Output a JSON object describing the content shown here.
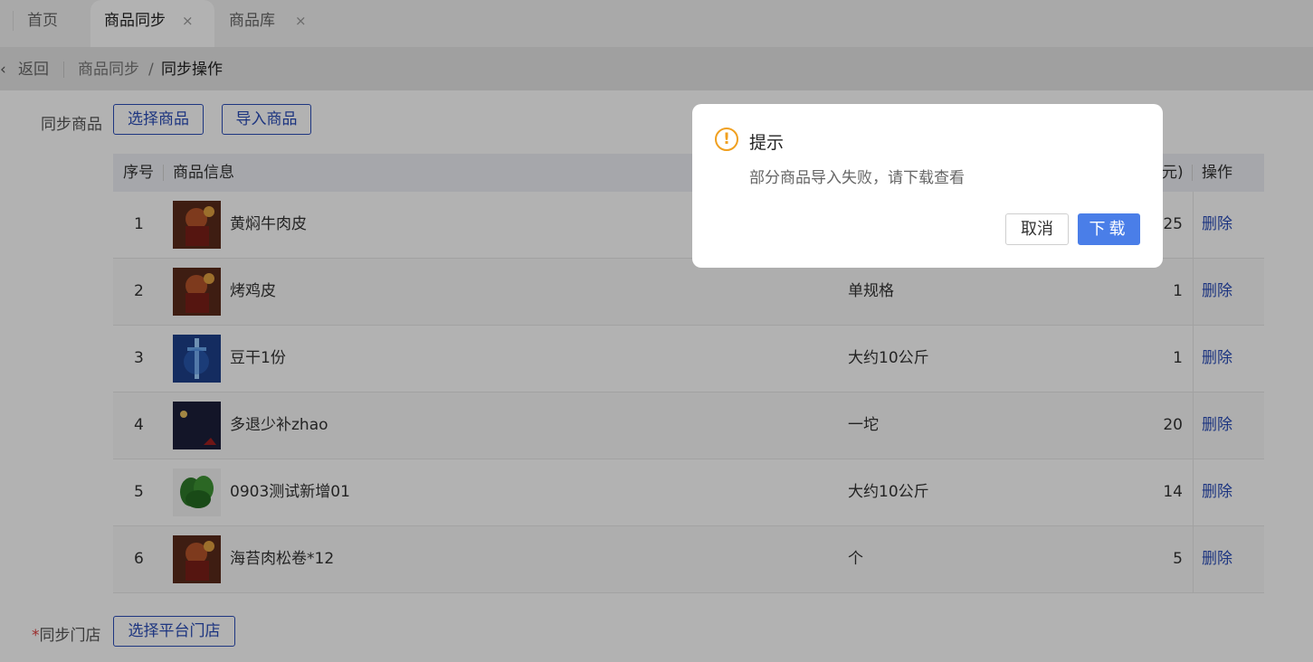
{
  "tabs": [
    {
      "label": "首页",
      "closable": false,
      "active": false
    },
    {
      "label": "商品同步",
      "closable": true,
      "active": true
    },
    {
      "label": "商品库",
      "closable": true,
      "active": false
    }
  ],
  "close_glyph": "×",
  "breadcrumb": {
    "back_label": "返回",
    "parent": "商品同步",
    "separator": "/",
    "current": "同步操作"
  },
  "form": {
    "sync_goods_label": "同步商品",
    "select_goods_button": "选择商品",
    "import_goods_button": "导入商品",
    "sync_store_required_mark": "*",
    "sync_store_label": "同步门店",
    "select_store_button": "选择平台门店"
  },
  "table": {
    "headers": {
      "index": "序号",
      "info": "商品信息",
      "price_partial": "元)",
      "action": "操作"
    },
    "rows": [
      {
        "index": "1",
        "name": "黄焖牛肉皮",
        "spec": "",
        "price": "25",
        "action": "删除",
        "thumb": "warrior-image"
      },
      {
        "index": "2",
        "name": "烤鸡皮",
        "spec": "单规格",
        "price": "1",
        "action": "删除",
        "thumb": "warrior-image"
      },
      {
        "index": "3",
        "name": "豆干1份",
        "spec": "大约10公斤",
        "price": "1",
        "action": "删除",
        "thumb": "sword-image"
      },
      {
        "index": "4",
        "name": "多退少补zhao",
        "spec": "一坨",
        "price": "20",
        "action": "删除",
        "thumb": "night-image"
      },
      {
        "index": "5",
        "name": "0903测试新增01",
        "spec": "大约10公斤",
        "price": "14",
        "action": "删除",
        "thumb": "vegetable-image"
      },
      {
        "index": "6",
        "name": "海苔肉松卷*12",
        "spec": "个",
        "price": "5",
        "action": "删除",
        "thumb": "warrior-image"
      }
    ]
  },
  "dialog": {
    "icon": "warning-icon",
    "title": "提示",
    "message": "部分商品导入失败，请下载查看",
    "cancel_label": "取消",
    "ok_label": "下载"
  },
  "colors": {
    "primary": "#2a4db8",
    "dialog_primary": "#4a7ee8",
    "warning": "#f0a020",
    "required": "#e04040"
  }
}
